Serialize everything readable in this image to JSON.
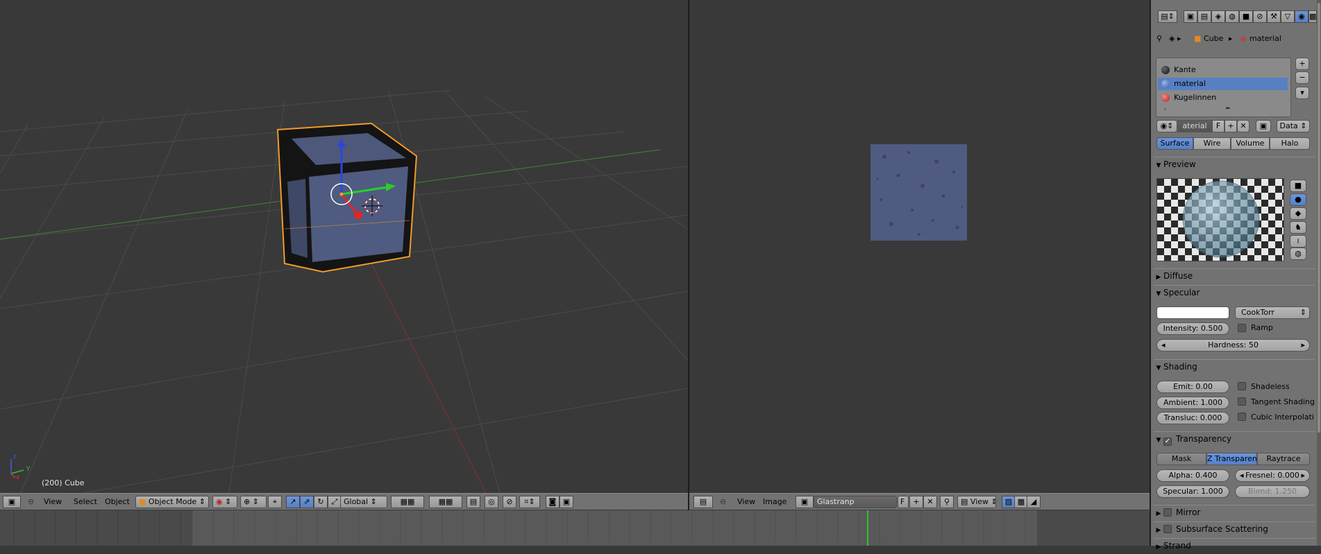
{
  "viewport3d": {
    "frame_info": "(200) Cube",
    "header": {
      "menu_view": "View",
      "menu_select": "Select",
      "menu_object": "Object",
      "mode": "Object Mode",
      "orientation": "Global"
    },
    "axis_labels": {
      "z": "z",
      "y": "y",
      "x": "x"
    }
  },
  "image_editor": {
    "header": {
      "menu_view": "View",
      "menu_image": "Image",
      "image_name": "Glastranp",
      "fake_user": "F",
      "view_mode": "View"
    }
  },
  "properties": {
    "breadcrumb": {
      "object": "Cube",
      "material": "material"
    },
    "materials": [
      {
        "name": "Kante",
        "color": "#111111",
        "selected": false
      },
      {
        "name": "material",
        "color": "#4d72b8",
        "selected": true
      },
      {
        "name": "Kugelinnen",
        "color": "#c0312a",
        "selected": false
      }
    ],
    "material_field": "aterial",
    "fake_user": "F",
    "link": "Data",
    "tabs": [
      "Surface",
      "Wire",
      "Volume",
      "Halo"
    ],
    "preview": {
      "title": "Preview"
    },
    "diffuse": {
      "title": "Diffuse"
    },
    "specular": {
      "title": "Specular",
      "shader": "CookTorr",
      "intensity": "Intensity: 0.500",
      "ramp": "Ramp",
      "hardness": "Hardness: 50"
    },
    "shading": {
      "title": "Shading",
      "emit": "Emit: 0.00",
      "ambient": "Ambient: 1.000",
      "transluc": "Transluc: 0.000",
      "shadeless": "Shadeless",
      "tangent": "Tangent Shading",
      "cubic": "Cubic Interpolati"
    },
    "transparency": {
      "title": "Transparency",
      "modes": [
        "Mask",
        "Z Transparenc",
        "Raytrace"
      ],
      "alpha": "Alpha: 0.400",
      "fresnel": "Fresnel: 0.000",
      "specular": "Specular: 1.000",
      "blend": "Blend: 1.250"
    },
    "mirror": {
      "title": "Mirror"
    },
    "sss": {
      "title": "Subsurface Scattering"
    },
    "strand": {
      "title": "Strand"
    }
  }
}
